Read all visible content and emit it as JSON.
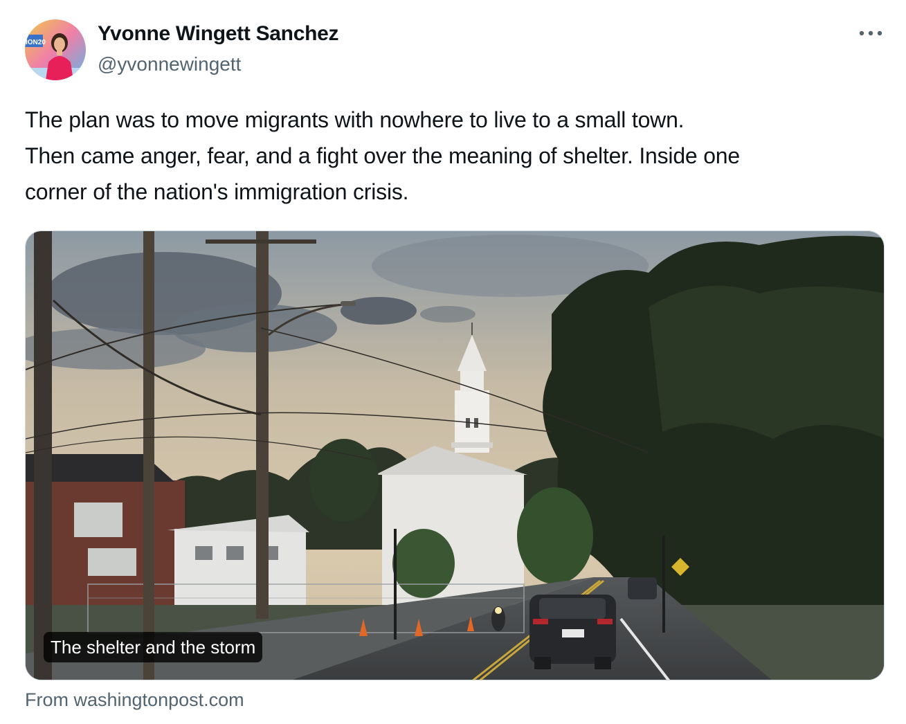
{
  "tweet": {
    "author": {
      "name": "Yvonne Wingett Sanchez",
      "handle": "@yvonnewingett",
      "avatar_icon": "profile-photo",
      "avatar_badge_text": "ION20"
    },
    "more_icon": "more-dots-icon",
    "text_lines": [
      "The plan was to move migrants with nowhere to live to a small town.",
      "Then came anger, fear, and a fight over the meaning of shelter. Inside one",
      "corner of the nation's immigration crisis."
    ],
    "link_card": {
      "caption": "The shelter and the storm",
      "source": "From washingtonpost.com",
      "image_description": "photo-street-church-dusk"
    }
  },
  "colors": {
    "text_primary": "#0f1419",
    "text_secondary": "#536471",
    "card_border": "#cfd9de"
  }
}
